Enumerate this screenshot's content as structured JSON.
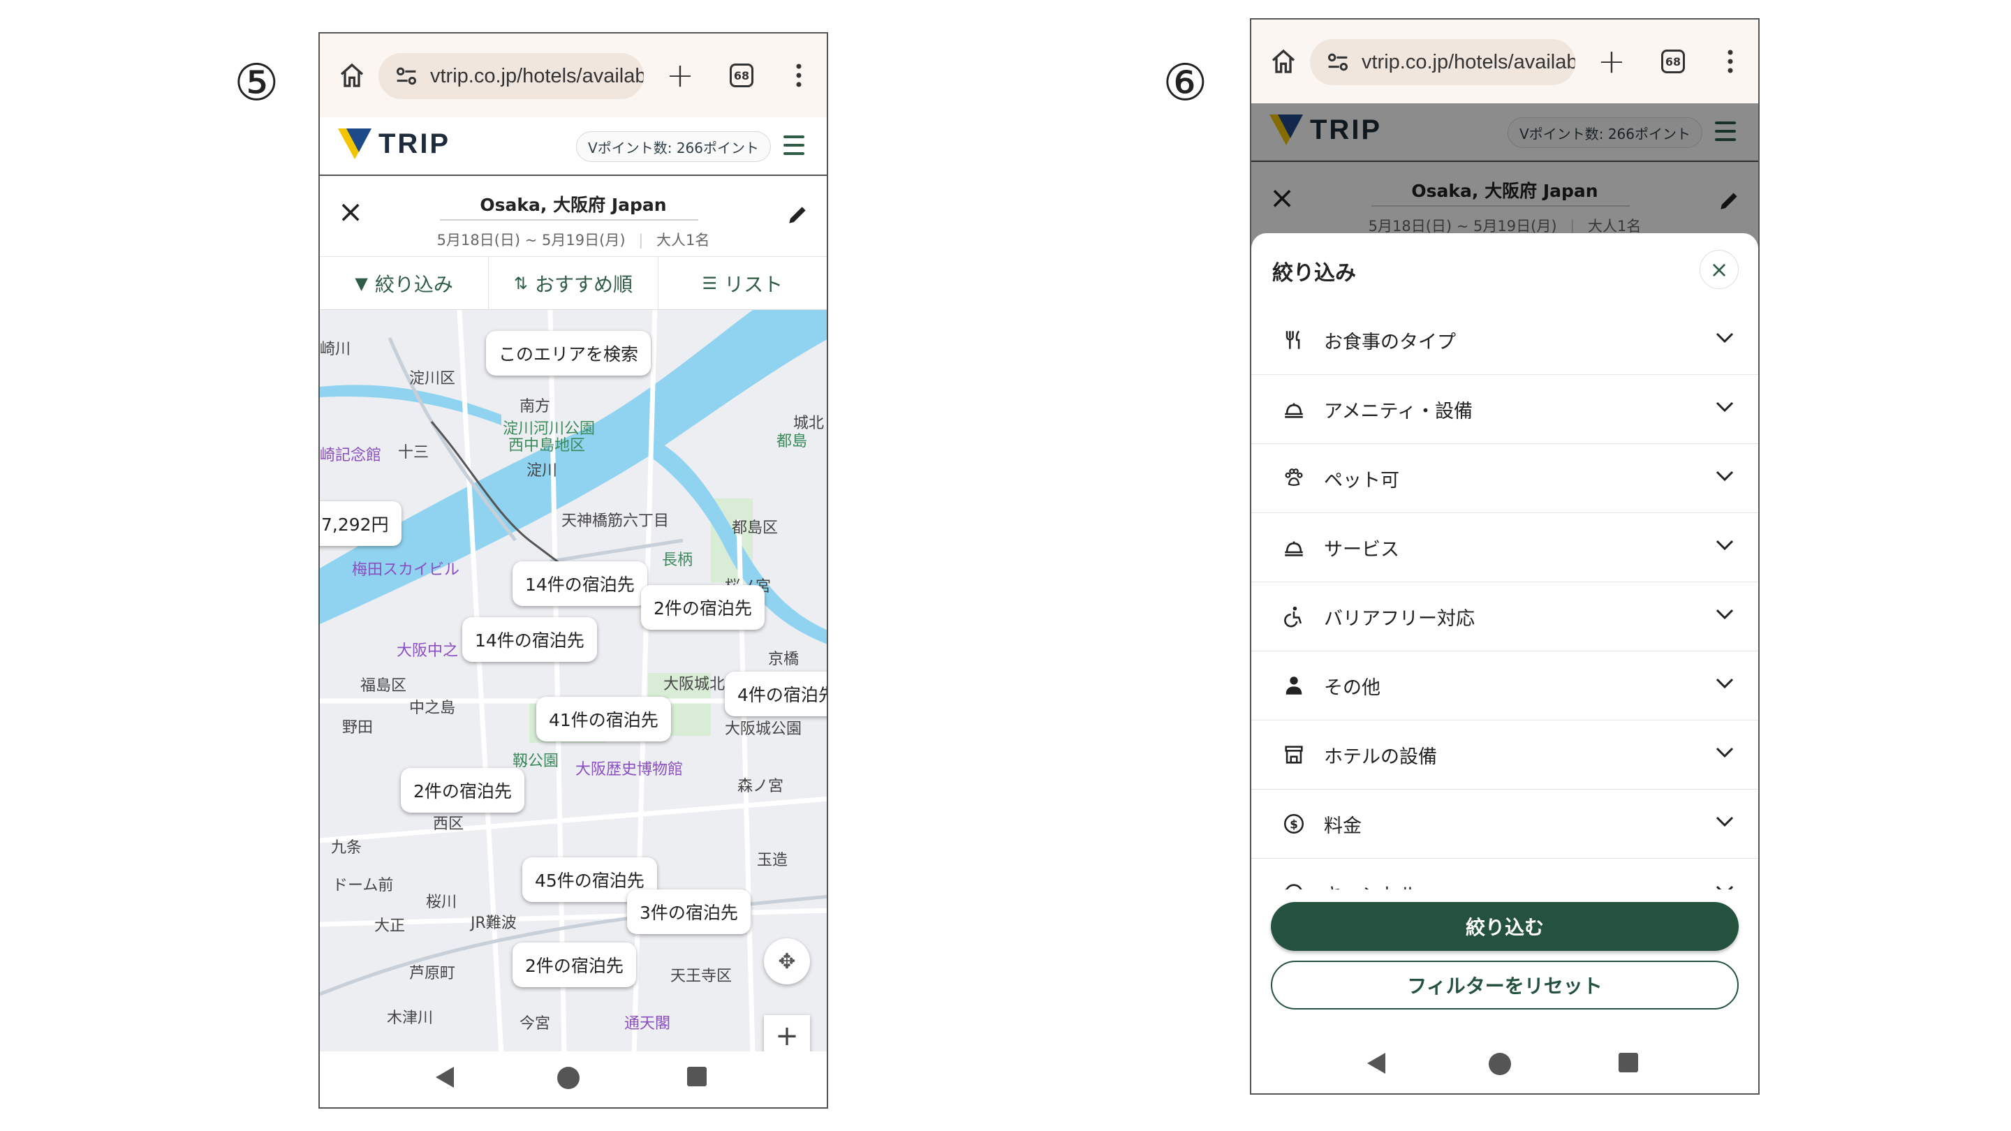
{
  "step_labels": {
    "left": "⑤",
    "right": "⑥"
  },
  "browser": {
    "url": "vtrip.co.jp/hotels/availab",
    "tab_count": "68"
  },
  "site": {
    "logo_text": "TRIP",
    "points_badge": "Vポイント数: 266ポイント"
  },
  "search": {
    "destination": "Osaka, 大阪府 Japan",
    "dates": "5月18日(日) ~ 5月19日(月)",
    "guests": "大人1名"
  },
  "sortbar": {
    "filter_label": "絞り込み",
    "sort_label": "おすすめ順",
    "view_label": "リスト"
  },
  "map": {
    "search_area_button": "このエリアを検索",
    "price_pill": "7,292円",
    "clusters": [
      "14件の宿泊先",
      "2件の宿泊先",
      "14件の宿泊先",
      "41件の宿泊先",
      "4件の宿泊先",
      "2件の宿泊先",
      "45件の宿泊先",
      "3件の宿泊先",
      "2件の宿泊先"
    ],
    "place_labels": [
      "淀川区",
      "崎川",
      "南方",
      "淀川河川公園",
      "西中島地区",
      "崎記念館",
      "十三",
      "天神橋筋六丁目",
      "都島区",
      "梅田スカイビル",
      "城北",
      "桜ノ宮",
      "大阪中之",
      "福島区",
      "中之島",
      "京橋",
      "大阪城北",
      "野田",
      "大阪城公園",
      "靱公園",
      "大阪歴史博物館",
      "森ノ宮",
      "西区",
      "九条",
      "玉造",
      "ドーム前",
      "桜川",
      "大正",
      "JR難波",
      "芦原町",
      "天王寺区",
      "木津川",
      "今宮",
      "通天閣",
      "城北",
      "淀川",
      "長柄",
      "都島"
    ]
  },
  "filter_sheet": {
    "title": "絞り込み",
    "items": [
      {
        "label": "お食事のタイプ",
        "icon": "utensils-icon"
      },
      {
        "label": "アメニティ・設備",
        "icon": "amenity-icon"
      },
      {
        "label": "ペット可",
        "icon": "paw-icon"
      },
      {
        "label": "サービス",
        "icon": "service-icon"
      },
      {
        "label": "バリアフリー対応",
        "icon": "accessible-icon"
      },
      {
        "label": "その他",
        "icon": "person-icon"
      },
      {
        "label": "ホテルの設備",
        "icon": "building-icon"
      },
      {
        "label": "料金",
        "icon": "dollar-icon"
      },
      {
        "label": "キャンセル",
        "icon": "cancel-icon"
      }
    ],
    "apply_button": "絞り込む",
    "reset_button": "フィルターをリセット"
  },
  "colors": {
    "brand_green": "#24523f",
    "logo_yellow": "#f2c500",
    "logo_blue": "#1f4a8a"
  }
}
